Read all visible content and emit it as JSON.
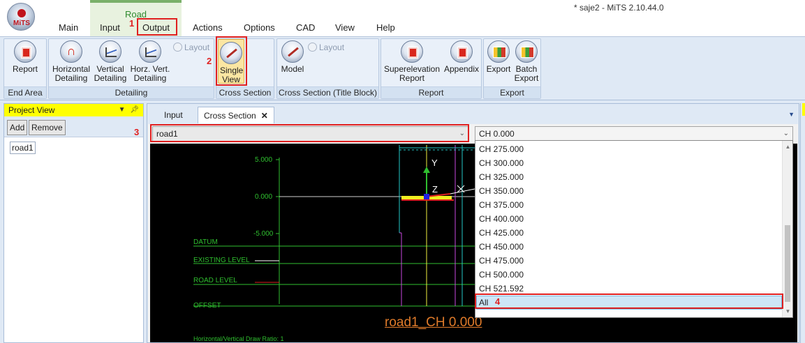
{
  "window": {
    "title": "* saje2 - MiTS 2.10.44.0",
    "logo_text": "MiTS"
  },
  "context_tab": {
    "label": "Road"
  },
  "menu": {
    "main": "Main",
    "input": "Input",
    "output": "Output",
    "actions": "Actions",
    "options": "Options",
    "cad": "CAD",
    "view": "View",
    "help": "Help"
  },
  "ribbon": {
    "end_area": {
      "label": "End Area",
      "report": "Report"
    },
    "detailing": {
      "label": "Detailing",
      "horizontal": [
        "Horizontal",
        "Detailing"
      ],
      "vertical": [
        "Vertical",
        "Detailing"
      ],
      "horz_vert": [
        "Horz. Vert.",
        "Detailing"
      ],
      "layout": "Layout"
    },
    "cross_section": {
      "label": "Cross Section",
      "single_view": [
        "Single",
        "View"
      ]
    },
    "cross_section_title": {
      "label": "Cross Section (Title Block)",
      "model": "Model",
      "layout": "Layout"
    },
    "report": {
      "label": "Report",
      "superelevation": [
        "Superelevation",
        "Report"
      ],
      "appendix": "Appendix"
    },
    "export": {
      "label": "Export",
      "export": "Export",
      "batch": [
        "Batch",
        "Export"
      ]
    }
  },
  "project_view": {
    "title": "Project View",
    "add": "Add",
    "remove": "Remove",
    "items": [
      "road1"
    ]
  },
  "doc_tabs": {
    "input": "Input",
    "cross_section": "Cross Section"
  },
  "road_combo": {
    "value": "road1"
  },
  "chainage_combo": {
    "value": "CH 0.000"
  },
  "chainage_options": [
    "CH 275.000",
    "CH 300.000",
    "CH 325.000",
    "CH 350.000",
    "CH 375.000",
    "CH 400.000",
    "CH 425.000",
    "CH 450.000",
    "CH 475.000",
    "CH 500.000",
    "CH 521.592",
    "All"
  ],
  "cad": {
    "y_ticks": [
      "5.000",
      "0.000",
      "-5.000"
    ],
    "row_labels": [
      "DATUM",
      "EXISTING LEVEL",
      "ROAD LEVEL",
      "OFFSET"
    ],
    "axis_y": "Y",
    "axis_z": "Z",
    "section_title": "road1_CH 0.000",
    "ratio_note": "Horizontal/Vertical Draw Ratio: 1"
  },
  "annotations": [
    "1",
    "2",
    "3",
    "4"
  ],
  "colors": {
    "accent_yellow": "#ffff00",
    "highlight": "#e02020",
    "cad_green": "#2fbf2f",
    "cad_orange": "#e07b2a"
  }
}
